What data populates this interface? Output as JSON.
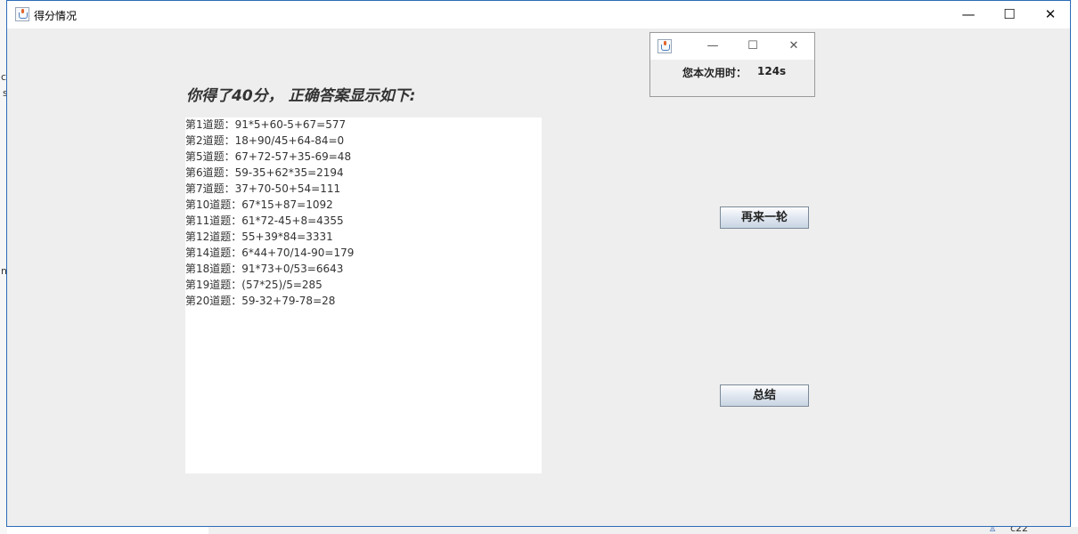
{
  "main_window": {
    "title": "得分情况",
    "heading": "你得了40分， 正确答案显示如下:",
    "answers": [
      "第1道题：91*5+60-5+67=577",
      "第2道题：18+90/45+64-84=0",
      "第5道题：67+72-57+35-69=48",
      "第6道题：59-35+62*35=2194",
      "第7道题：37+70-50+54=111",
      "第10道题：67*15+87=1092",
      "第11道题：61*72-45+8=4355",
      "第12道题：55+39*84=3331",
      "第14道题：6*44+70/14-90=179",
      "第18道题：91*73+0/53=6643",
      "第19道题：(57*25)/5=285",
      "第20道题：59-32+79-78=28"
    ],
    "again_button": "再来一轮",
    "summary_button": "总结",
    "window_controls": {
      "minimize": "—",
      "maximize": "☐",
      "close": "✕"
    }
  },
  "timer_window": {
    "label": "您本次用时：",
    "value": "124s",
    "window_controls": {
      "minimize": "—",
      "maximize": "☐",
      "close": "✕"
    }
  },
  "background": {
    "bottom_text": "c22",
    "left_fragments": [
      "c",
      "s",
      "n"
    ]
  }
}
